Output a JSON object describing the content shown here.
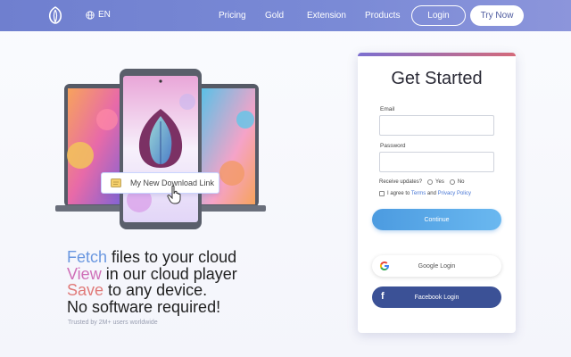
{
  "nav": {
    "lang": "EN",
    "links": [
      "Pricing",
      "Gold",
      "Extension",
      "Products"
    ],
    "login": "Login",
    "try_now": "Try Now"
  },
  "hero": {
    "chip_text": "My New Download Link"
  },
  "tagline": {
    "line1_kw": "Fetch",
    "line1_rest": " files to your cloud",
    "line2_kw": "View",
    "line2_rest": " in our cloud player",
    "line3_kw": "Save",
    "line3_rest": " to any device.",
    "line4": "No software required!",
    "trusted": "Trusted by 2M+ users worldwide"
  },
  "card": {
    "title": "Get Started",
    "email_label": "Email",
    "email_value": "",
    "password_label": "Password",
    "password_value": "",
    "updates_label": "Receive updates?",
    "yes": "Yes",
    "no": "No",
    "agree_prefix": "I agree to ",
    "terms": "Terms",
    "and": " and ",
    "privacy": "Privacy Policy",
    "continue": "Continue",
    "google": "Google Login",
    "facebook": "Facebook Login"
  },
  "colors": {
    "nav_bg": "#7383d2",
    "fetch": "#6a97e0",
    "view": "#cf6fb8",
    "save": "#e07a79",
    "continue": "#5aa9e8",
    "facebook": "#3b5196"
  },
  "icons": [
    "logo-icon",
    "globe-icon",
    "file-icon",
    "pointer-hand-icon",
    "google-icon",
    "facebook-icon"
  ]
}
